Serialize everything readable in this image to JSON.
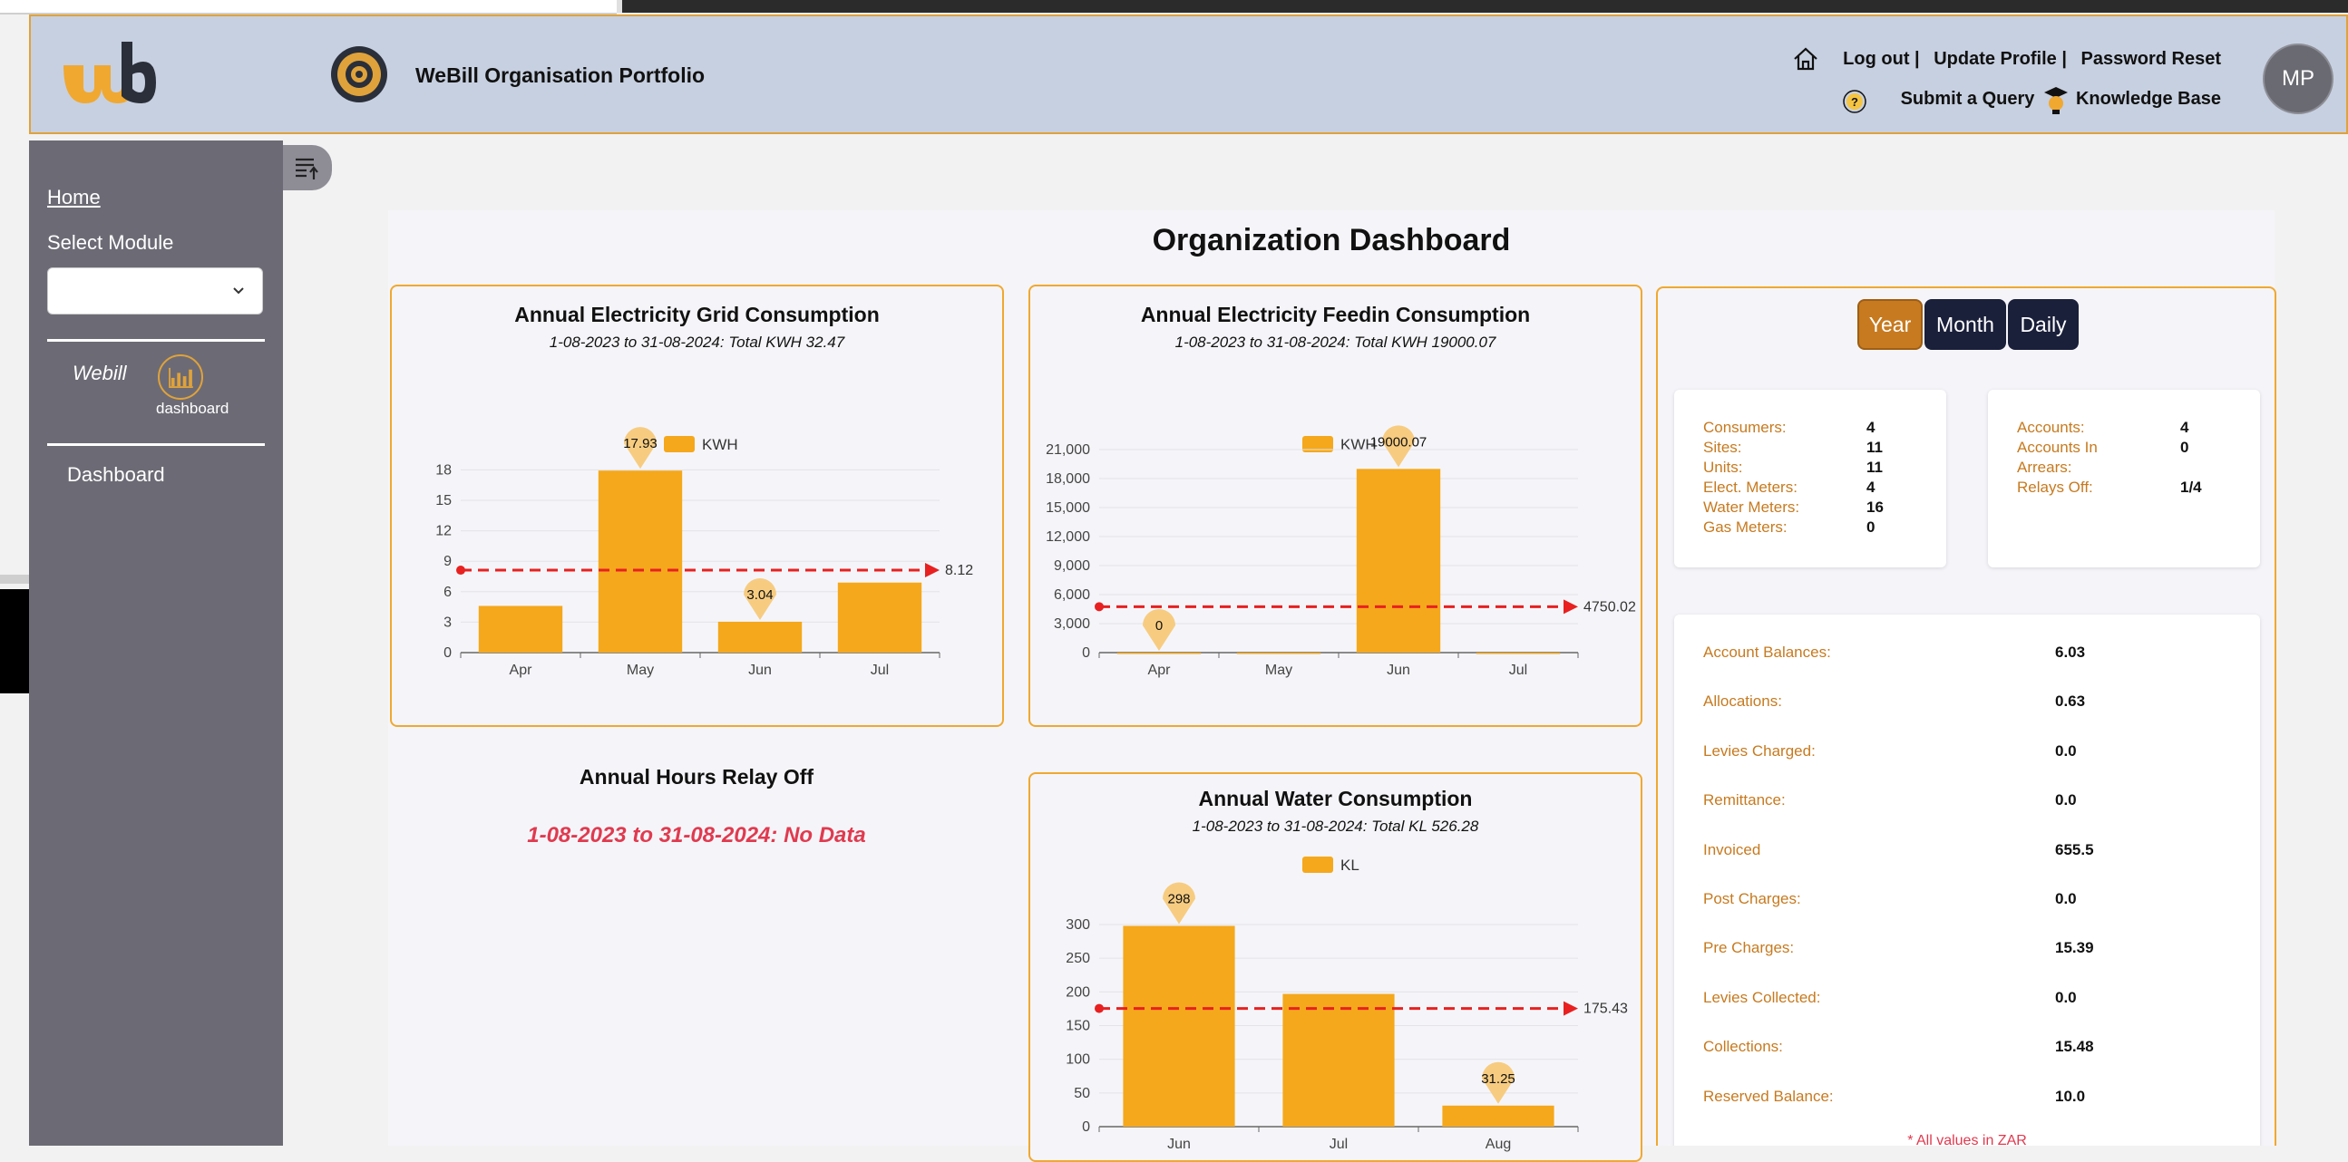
{
  "header": {
    "title": "WeBill Organisation Portfolio",
    "links_row1": [
      "Log out |",
      "Update Profile |",
      "Password Reset"
    ],
    "links_row2": [
      "Submit a Query",
      "Knowledge Base"
    ],
    "avatar_initials": "MP",
    "icons": [
      "webill-logo",
      "org-gear-icon",
      "home-icon",
      "question-icon",
      "graduation-bulb-icon"
    ]
  },
  "sidebar": {
    "home": "Home",
    "select_module_label": "Select Module",
    "select_value": "",
    "module_name": "Webill",
    "module_icon_label": "dashboard",
    "dashboard_link": "Dashboard"
  },
  "main": {
    "title": "Organization Dashboard",
    "relay_title": "Annual Hours Relay Off",
    "relay_nodata": "1-08-2023 to 31-08-2024: No Data"
  },
  "chart_data": [
    {
      "type": "bar",
      "title": "Annual Electricity Grid Consumption",
      "subtitle": "1-08-2023 to 31-08-2024: Total KWH 32.47",
      "legend": "KWH",
      "categories": [
        "Apr",
        "May",
        "Jun",
        "Jul"
      ],
      "values": [
        4.6,
        17.93,
        3.04,
        6.9
      ],
      "max_label": "17.93",
      "min_label": "3.04",
      "average": 8.12,
      "average_label": "8.12",
      "yticks": [
        "0",
        "3",
        "6",
        "9",
        "12",
        "15",
        "18"
      ],
      "ylim": [
        0,
        20
      ],
      "color": "#f5a81c"
    },
    {
      "type": "bar",
      "title": "Annual Electricity Feedin Consumption",
      "subtitle": "1-08-2023 to 31-08-2024: Total KWH 19000.07",
      "legend": "KWH",
      "categories": [
        "Apr",
        "May",
        "Jun",
        "Jul"
      ],
      "values": [
        0,
        0,
        19000.07,
        0
      ],
      "max_label": "19000.07",
      "min_label": "0",
      "average": 4750.02,
      "average_label": "4750.02",
      "yticks": [
        "0",
        "3,000",
        "6,000",
        "9,000",
        "12,000",
        "15,000",
        "18,000",
        "21,000"
      ],
      "ylim": [
        0,
        21000
      ],
      "color": "#f5a81c"
    },
    {
      "type": "bar",
      "title": "Annual Water Consumption",
      "subtitle": "1-08-2023 to 31-08-2024: Total KL 526.28",
      "legend": "KL",
      "categories": [
        "Jun",
        "Jul",
        "Aug"
      ],
      "values": [
        298,
        197,
        31.25
      ],
      "max_label": "298",
      "min_label": "31.25",
      "average": 175.43,
      "average_label": "175.43",
      "yticks": [
        "0",
        "50",
        "100",
        "150",
        "200",
        "250",
        "300"
      ],
      "ylim": [
        0,
        300
      ],
      "color": "#f5a81c"
    }
  ],
  "summary": {
    "periods": [
      "Year",
      "Month",
      "Daily"
    ],
    "active_period": "Year",
    "left_stats": [
      {
        "label": "Consumers:",
        "value": "4"
      },
      {
        "label": "Sites:",
        "value": "11"
      },
      {
        "label": "Units:",
        "value": "11"
      },
      {
        "label": "Elect. Meters:",
        "value": "4"
      },
      {
        "label": "Water Meters:",
        "value": "16"
      },
      {
        "label": "Gas Meters:",
        "value": "0"
      }
    ],
    "right_stats": [
      {
        "label": "Accounts:",
        "value": "4"
      },
      {
        "label": "Accounts In",
        "value": "0"
      },
      {
        "label": "Arrears:",
        "value": ""
      },
      {
        "label": "Relays Off:",
        "value": "1/4"
      }
    ],
    "balances": [
      {
        "label": "Account Balances:",
        "value": "6.03"
      },
      {
        "label": "Allocations:",
        "value": "0.63"
      },
      {
        "label": "Levies Charged:",
        "value": "0.0"
      },
      {
        "label": "Remittance:",
        "value": "0.0"
      },
      {
        "label": "Invoiced",
        "value": "655.5"
      },
      {
        "label": "Post Charges:",
        "value": "0.0"
      },
      {
        "label": "Pre Charges:",
        "value": "15.39"
      },
      {
        "label": "Levies Collected:",
        "value": "0.0"
      },
      {
        "label": "Collections:",
        "value": "15.48"
      },
      {
        "label": "Reserved Balance:",
        "value": "10.0"
      }
    ],
    "note": "* All values in ZAR"
  }
}
